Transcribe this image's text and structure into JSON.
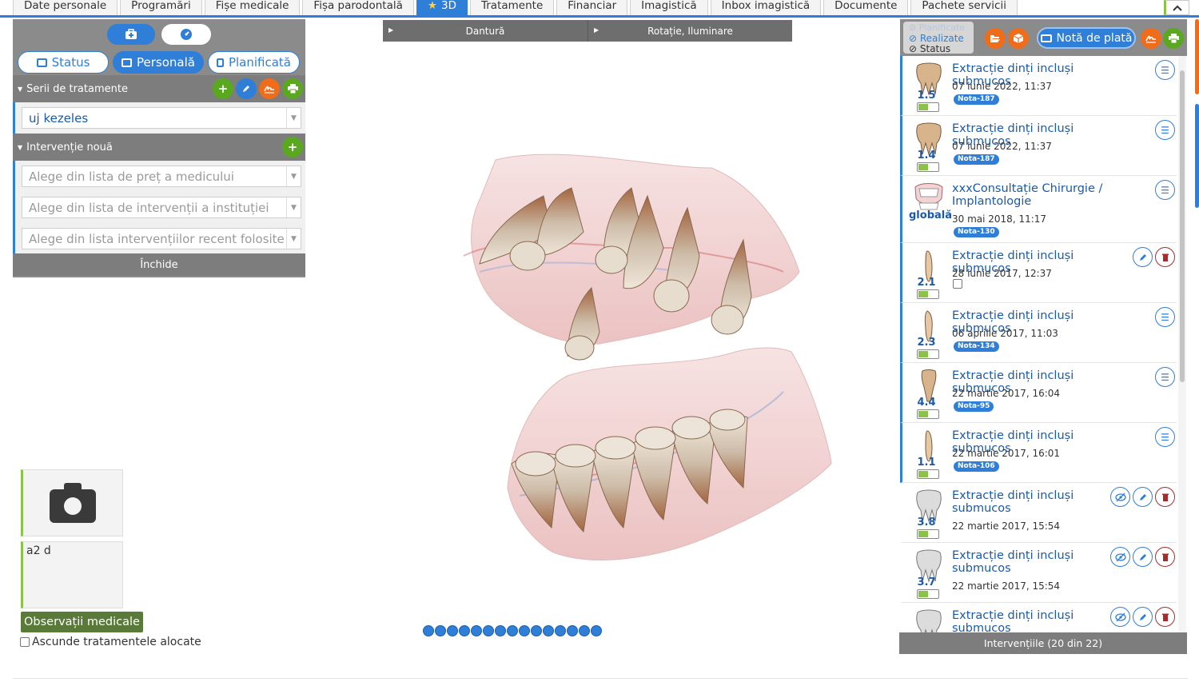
{
  "tabs": [
    {
      "label": "Date personale"
    },
    {
      "label": "Programări"
    },
    {
      "label": "Fișe medicale"
    },
    {
      "label": "Fișa parodontală"
    },
    {
      "label": "3D",
      "active": true
    },
    {
      "label": "Tratamente"
    },
    {
      "label": "Financiar"
    },
    {
      "label": "Imagistică"
    },
    {
      "label": "Inbox imagistică"
    },
    {
      "label": "Documente"
    },
    {
      "label": "Pachete servicii"
    }
  ],
  "left_panel": {
    "views": {
      "status": "Status",
      "personal": "Personală",
      "planned": "Planificată"
    },
    "series_header": "Serii de tratamente",
    "series_value": "uj kezeles",
    "new_intervention_header": "Intervenție nouă",
    "placeholders": {
      "doctor_prices": "Alege din lista de preț a medicului",
      "institution": "Alege din lista de intervenții a instituției",
      "recent": "Alege din lista intervențiilor recent folosite"
    },
    "close_label": "Închide"
  },
  "notes": {
    "text": "a2 d",
    "observations_button": "Observații medicale",
    "hide_allocated": "Ascunde tratamentele alocate"
  },
  "viewer": {
    "bar": {
      "left": "Dantură",
      "right": "Rotație, Iluminare"
    },
    "page_count": 15
  },
  "right_panel": {
    "filters": {
      "planned": "Planificate",
      "done": "Realizate",
      "status": "Status"
    },
    "nota_button": "Notă de plată",
    "items": [
      {
        "title": "Extracție dinți incluși submucos",
        "date": "07 iunie 2022, 11:37",
        "badge": "Nota-187",
        "tooth": "1.5"
      },
      {
        "title": "Extracție dinți incluși submucos",
        "date": "07 iunie 2022, 11:37",
        "badge": "Nota-187",
        "tooth": "1.4"
      },
      {
        "title": "xxxConsultație Chirurgie / Implantologie",
        "date": "30 mai 2018, 11:17",
        "badge": "Nota-130",
        "tooth": "globală"
      },
      {
        "title": "Extracție dinți incluși submucos",
        "date": "28 iunie 2017, 12:37",
        "badge": "",
        "tooth": "2.1"
      },
      {
        "title": "Extracție dinți incluși submucos",
        "date": "06 aprilie 2017, 11:03",
        "badge": "Nota-134",
        "tooth": "2.3"
      },
      {
        "title": "Extracție dinți incluși submucos",
        "date": "22 martie 2017, 16:04",
        "badge": "Nota-95",
        "tooth": "4.4"
      },
      {
        "title": "Extracție dinți incluși submucos",
        "date": "22 martie 2017, 16:01",
        "badge": "Nota-106",
        "tooth": "1.1"
      },
      {
        "title": "Extracție dinți incluși submucos",
        "date": "22 martie 2017, 15:54",
        "badge": "",
        "tooth": "3.8"
      },
      {
        "title": "Extracție dinți incluși submucos",
        "date": "22 martie 2017, 15:54",
        "badge": "",
        "tooth": "3.7"
      },
      {
        "title": "Extracție dinți incluși submucos",
        "date": "",
        "badge": "",
        "tooth": ""
      }
    ],
    "footer": "Intervențiile (20 din 22)"
  },
  "colors": {
    "accent": "#2f7ed8",
    "green": "#5aa81f",
    "orange": "#ef6c1a",
    "danger": "#a52c2c",
    "panel_gray": "#8b8b8b"
  }
}
